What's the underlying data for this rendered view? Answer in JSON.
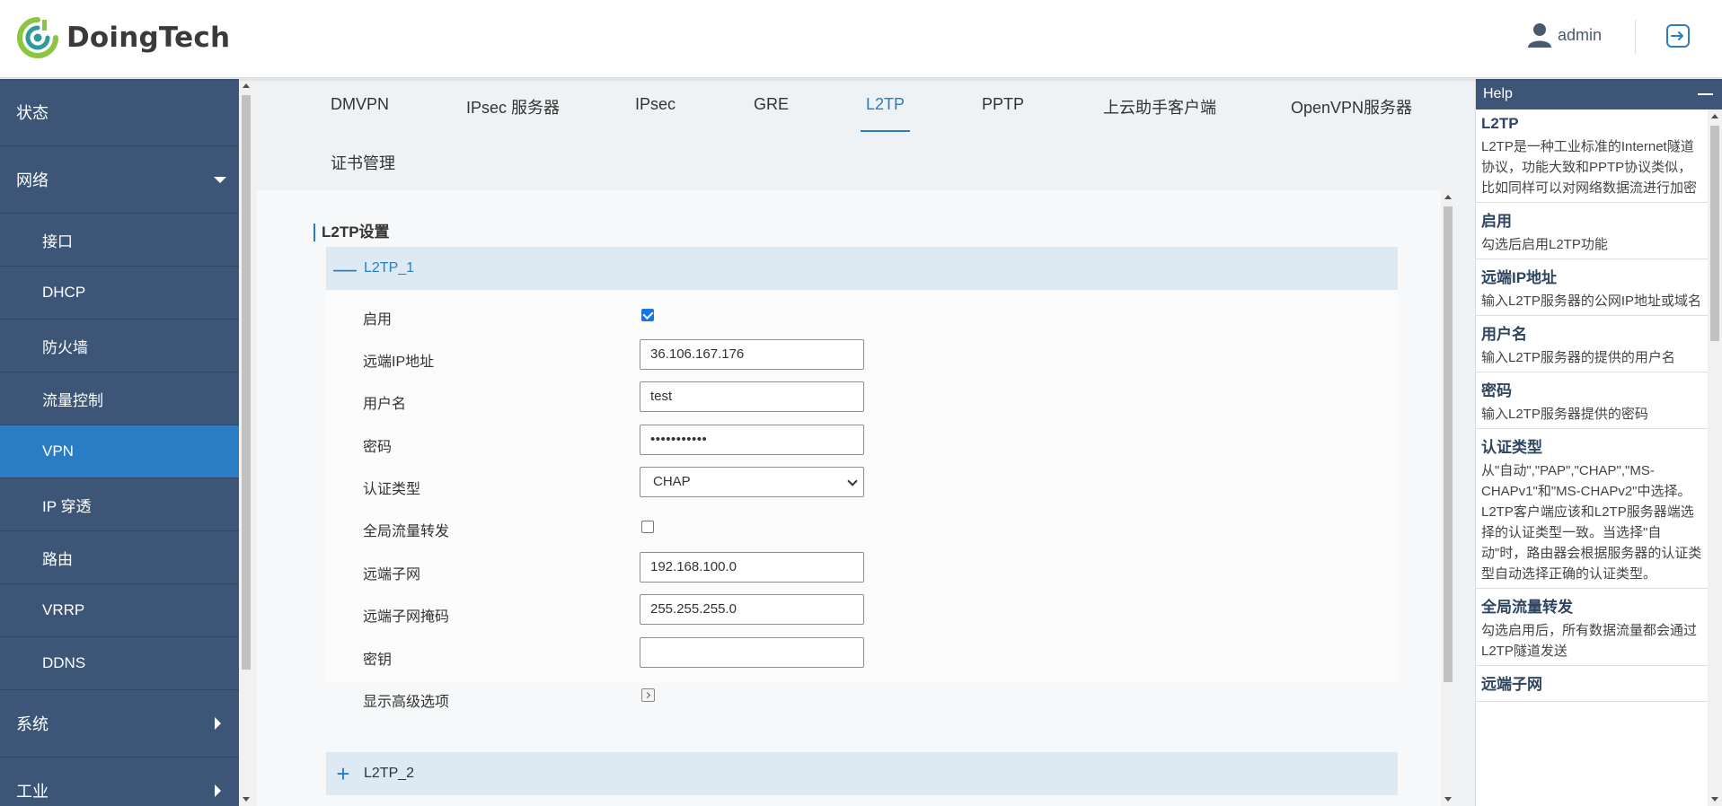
{
  "brand": {
    "name": "DoingTech"
  },
  "header": {
    "user": "admin"
  },
  "sidebar": {
    "items": [
      {
        "label": "状态",
        "level": "top"
      },
      {
        "label": "网络",
        "level": "top",
        "expanded": true
      },
      {
        "label": "接口",
        "level": "sub"
      },
      {
        "label": "DHCP",
        "level": "sub"
      },
      {
        "label": "防火墙",
        "level": "sub"
      },
      {
        "label": "流量控制",
        "level": "sub"
      },
      {
        "label": "VPN",
        "level": "sub",
        "active": true
      },
      {
        "label": "IP 穿透",
        "level": "sub"
      },
      {
        "label": "路由",
        "level": "sub"
      },
      {
        "label": "VRRP",
        "level": "sub"
      },
      {
        "label": "DDNS",
        "level": "sub"
      },
      {
        "label": "系统",
        "level": "top"
      },
      {
        "label": "工业",
        "level": "top"
      }
    ]
  },
  "tabs": [
    {
      "label": "DMVPN"
    },
    {
      "label": "IPsec 服务器"
    },
    {
      "label": "IPsec"
    },
    {
      "label": "GRE"
    },
    {
      "label": "L2TP",
      "active": true
    },
    {
      "label": "PPTP"
    },
    {
      "label": "上云助手客户端"
    },
    {
      "label": "OpenVPN服务器"
    },
    {
      "label": "证书管理"
    }
  ],
  "section": {
    "title": "L2TP设置"
  },
  "panels": [
    {
      "title": "L2TP_1",
      "expanded": true,
      "sign": "—"
    },
    {
      "title": "L2TP_2",
      "expanded": false,
      "sign": "+"
    }
  ],
  "form": {
    "enable": {
      "label": "启用",
      "checked": true
    },
    "remote_ip": {
      "label": "远端IP地址",
      "value": "36.106.167.176"
    },
    "username": {
      "label": "用户名",
      "value": "test"
    },
    "password": {
      "label": "密码",
      "value": "•••••••••••"
    },
    "auth_type": {
      "label": "认证类型",
      "value": "CHAP"
    },
    "global_forward": {
      "label": "全局流量转发",
      "checked": false
    },
    "remote_subnet": {
      "label": "远端子网",
      "value": "192.168.100.0"
    },
    "remote_mask": {
      "label": "远端子网掩码",
      "value": "255.255.255.0"
    },
    "secret": {
      "label": "密钥",
      "value": ""
    },
    "advanced": {
      "label": "显示高级选项"
    }
  },
  "help": {
    "title": "Help",
    "sections": [
      {
        "title": "L2TP",
        "text": "L2TP是一种工业标准的Internet隧道协议，功能大致和PPTP协议类似，比如同样可以对网络数据流进行加密"
      },
      {
        "title": "启用",
        "text": "勾选后启用L2TP功能"
      },
      {
        "title": "远端IP地址",
        "text": "输入L2TP服务器的公网IP地址或域名"
      },
      {
        "title": "用户名",
        "text": "输入L2TP服务器的提供的用户名"
      },
      {
        "title": "密码",
        "text": "输入L2TP服务器提供的密码"
      },
      {
        "title": "认证类型",
        "text": "从\"自动\",\"PAP\",\"CHAP\",\"MS-CHAPv1\"和\"MS-CHAPv2\"中选择。L2TP客户端应该和L2TP服务器端选择的认证类型一致。当选择\"自动\"时，路由器会根据服务器的认证类型自动选择正确的认证类型。"
      },
      {
        "title": "全局流量转发",
        "text": "勾选启用后，所有数据流量都会通过L2TP隧道发送"
      },
      {
        "title": "远端子网",
        "text": ""
      }
    ]
  },
  "colors": {
    "sidebar": "#3d5677",
    "accent": "#2b7dc3",
    "panel_head": "#dde9f3"
  }
}
